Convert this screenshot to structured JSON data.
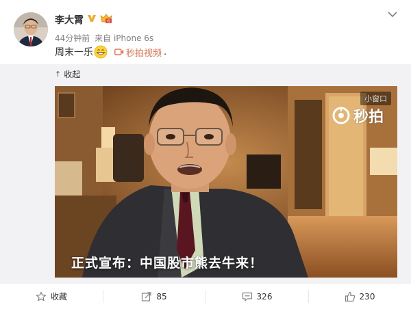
{
  "post": {
    "author": "李大霄",
    "time": "44分钟前",
    "source_prefix": "来自",
    "source": "iPhone 6s",
    "text": "周末一乐",
    "video_link_label": "秒拍视频",
    "video_link_suffix": "."
  },
  "expanded": {
    "collapse_label": "收起",
    "mini_window_label": "小窗口",
    "watermark": "秒拍",
    "caption": "正式宣布：中国股市熊去牛来！"
  },
  "actions": {
    "favorite_label": "收藏",
    "repost_count": "85",
    "comment_count": "326",
    "like_count": "230"
  },
  "colors": {
    "link": "#eb7350",
    "verified": "#f5a623",
    "meta": "#808080"
  }
}
